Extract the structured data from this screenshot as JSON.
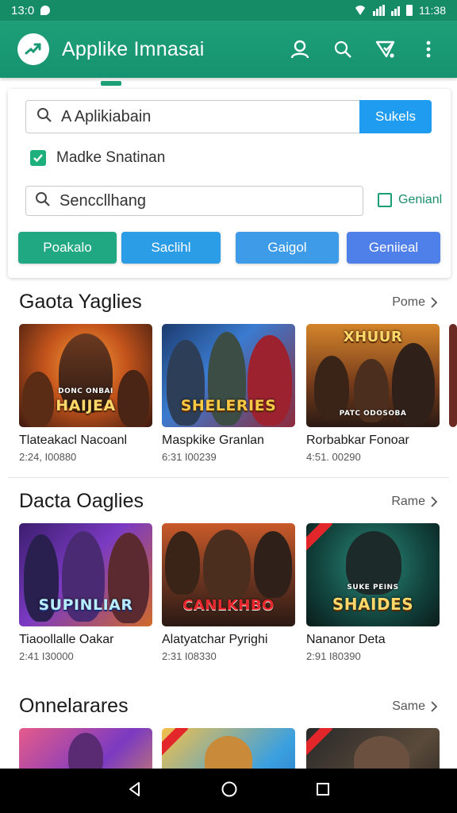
{
  "status_bar": {
    "time": "13:0",
    "right_time": "11:38"
  },
  "app_bar": {
    "title": "Applike Imnasai",
    "icons": [
      "account-icon",
      "search-icon",
      "cast-icon",
      "more-vert-icon"
    ]
  },
  "search_card": {
    "primary_search_value": "A Aplikiabain",
    "primary_search_button": "Sukels",
    "checkbox_label": "Madke Snatinan",
    "checkbox_checked": true,
    "secondary_search_placeholder": "Senccllhang",
    "secondary_checkbox_label": "Genianl",
    "secondary_checkbox_checked": false,
    "filter_buttons": [
      {
        "label": "Poakalo",
        "color": "#1fa882"
      },
      {
        "label": "Saclihl",
        "color": "#2b9ce6"
      },
      {
        "label": "Gaigol",
        "color": "#3d9be8"
      },
      {
        "label": "Geniieal",
        "color": "#4f7fe8"
      }
    ]
  },
  "sections": [
    {
      "title": "Gaota Yaglies",
      "more": "Pome",
      "tiles": [
        {
          "name": "Tlateakacl Nacoanl",
          "meta": "2:24, I00880",
          "overlay": "HAIJEA",
          "overlay_top": "DONC ONBAI"
        },
        {
          "name": "Maspkike Granlan",
          "meta": "6:31 I00239",
          "overlay": "SHELERIES",
          "overlay_top": ""
        },
        {
          "name": "Rorbabkar Fonoar",
          "meta": "4:51. 00290",
          "overlay": "XHUUR",
          "overlay_top": "PATC ODOSOBA"
        }
      ]
    },
    {
      "title": "Dacta Oaglies",
      "more": "Rame",
      "tiles": [
        {
          "name": "Tiaoollalle Oakar",
          "meta": "2:41 I30000",
          "overlay": "SUPINLIAR",
          "overlay_top": ""
        },
        {
          "name": "Alatyatchar Pyrighi",
          "meta": "2:31 I08330",
          "overlay": "CANLKHBO",
          "overlay_top": ""
        },
        {
          "name": "Nananor Deta",
          "meta": "2:91 I80390",
          "overlay": "SHAIDES",
          "overlay_top": "SUKE PEINS"
        }
      ]
    },
    {
      "title": "Onnelarares",
      "more": "Same",
      "tiles": [
        {
          "name": "",
          "meta": "",
          "overlay": "",
          "overlay_top": ""
        },
        {
          "name": "",
          "meta": "",
          "overlay": "",
          "overlay_top": ""
        },
        {
          "name": "",
          "meta": "",
          "overlay": "",
          "overlay_top": ""
        }
      ]
    }
  ],
  "nav_bar": {
    "buttons": [
      "back-icon",
      "home-icon",
      "recents-icon"
    ]
  }
}
